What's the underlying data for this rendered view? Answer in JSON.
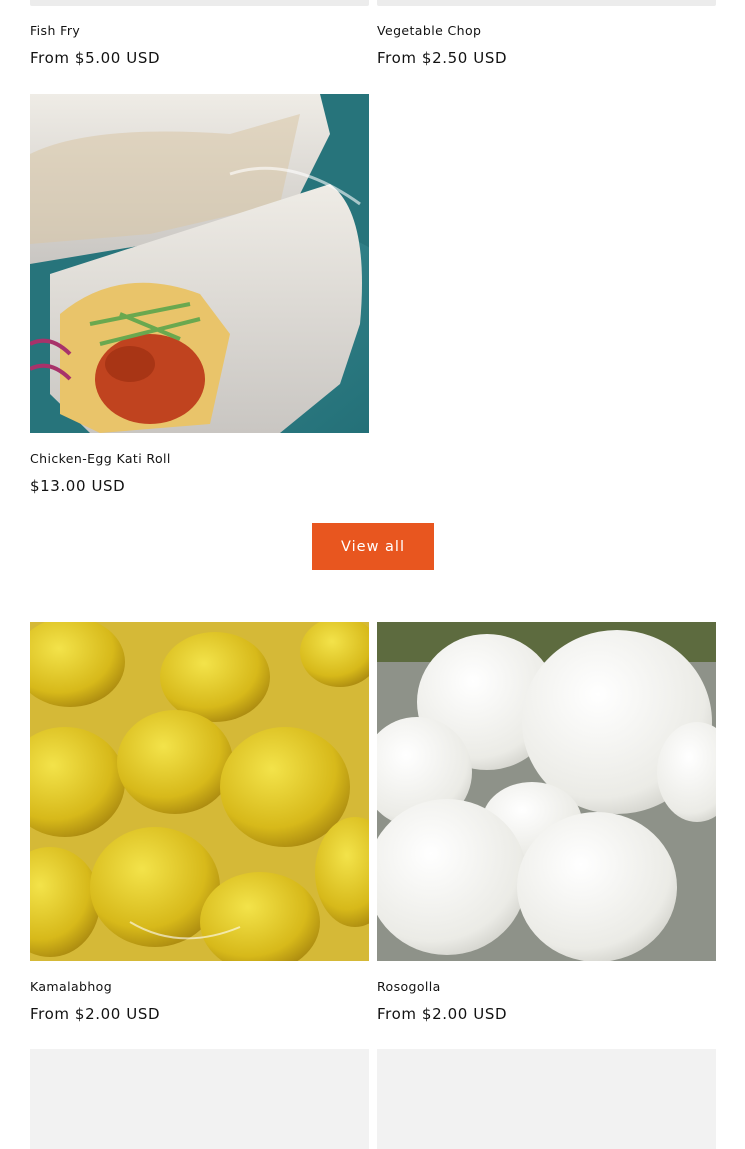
{
  "section1": {
    "products": [
      {
        "title": "Fish Fry",
        "price": "From $5.00 USD"
      },
      {
        "title": "Vegetable Chop",
        "price": "From $2.50 USD"
      },
      {
        "title": "Chicken-Egg Kati Roll",
        "price": "$13.00 USD"
      }
    ],
    "view_all_label": "View all"
  },
  "section2": {
    "products": [
      {
        "title": "Kamalabhog",
        "price": "From $2.00 USD"
      },
      {
        "title": "Rosogolla",
        "price": "From $2.00 USD"
      }
    ]
  },
  "colors": {
    "accent": "#e8561f",
    "placeholder": "#f2f2f2"
  }
}
